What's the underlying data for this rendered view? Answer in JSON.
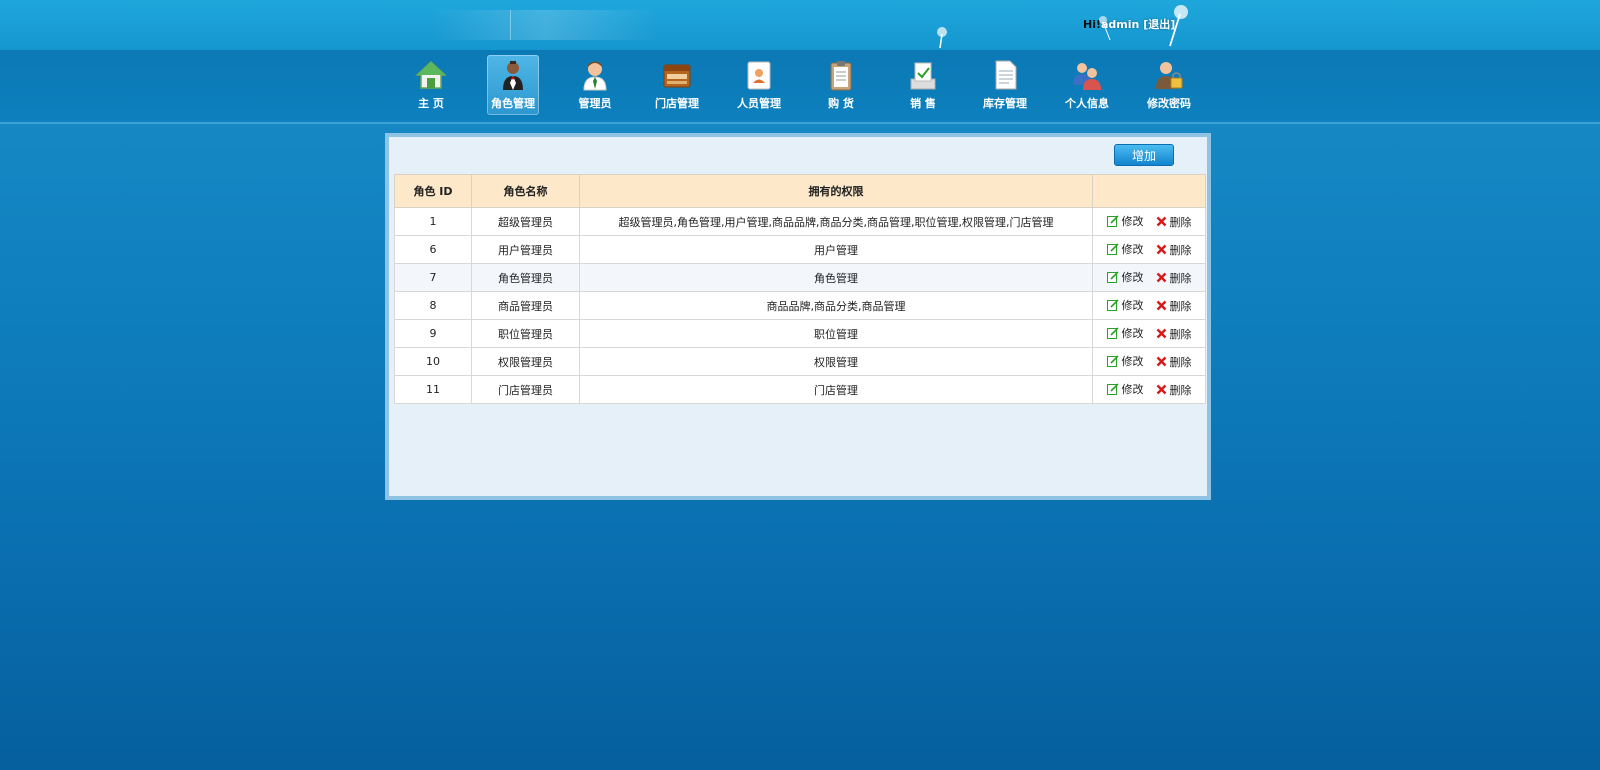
{
  "header": {
    "greeting": "Hi!",
    "username": "admin",
    "logout": "[退出]"
  },
  "nav": {
    "items": [
      {
        "label": "主  页",
        "icon": "home-icon"
      },
      {
        "label": "角色管理",
        "icon": "waiter-icon"
      },
      {
        "label": "管理员",
        "icon": "admin-user-icon"
      },
      {
        "label": "门店管理",
        "icon": "store-icon"
      },
      {
        "label": "人员管理",
        "icon": "staff-card-icon"
      },
      {
        "label": "购  货",
        "icon": "clipboard-icon"
      },
      {
        "label": "销  售",
        "icon": "sales-icon"
      },
      {
        "label": "库存管理",
        "icon": "inventory-doc-icon"
      },
      {
        "label": "个人信息",
        "icon": "users-icon"
      },
      {
        "label": "修改密码",
        "icon": "user-lock-icon"
      }
    ],
    "active_index": 1
  },
  "toolbar": {
    "add_label": "增加"
  },
  "table": {
    "headers": [
      "角色 ID",
      "角色名称",
      "拥有的权限",
      ""
    ],
    "edit_label": "修改",
    "delete_label": "删除",
    "rows": [
      {
        "id": "1",
        "name": "超级管理员",
        "perms": "超级管理员,角色管理,用户管理,商品品牌,商品分类,商品管理,职位管理,权限管理,门店管理"
      },
      {
        "id": "6",
        "name": "用户管理员",
        "perms": "用户管理"
      },
      {
        "id": "7",
        "name": "角色管理员",
        "perms": "角色管理"
      },
      {
        "id": "8",
        "name": "商品管理员",
        "perms": "商品品牌,商品分类,商品管理"
      },
      {
        "id": "9",
        "name": "职位管理员",
        "perms": "职位管理"
      },
      {
        "id": "10",
        "name": "权限管理员",
        "perms": "权限管理"
      },
      {
        "id": "11",
        "name": "门店管理员",
        "perms": "门店管理"
      }
    ]
  },
  "colors": {
    "header_bg": "#1596cf",
    "nav_bg": "#0b79b5",
    "table_header_bg": "#fde9c9",
    "panel_bg": "#e5f0f8",
    "edit_icon": "#2e9e2e",
    "delete_icon": "#d41b1b"
  }
}
